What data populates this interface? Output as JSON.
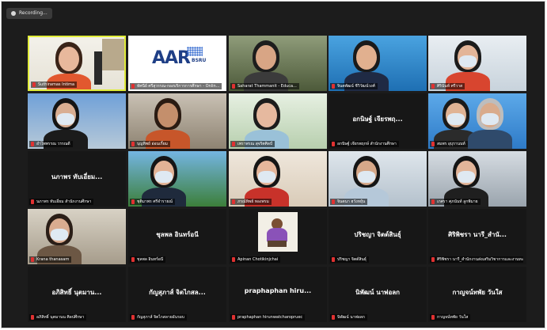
{
  "recording": {
    "label": "Recording..."
  },
  "tiles": [
    {
      "name": "Suthiramas Intima"
    },
    {
      "name": "ทัศนีย์ ศรีสุวรรณ-กองบริการการศึกษา - Onlin..."
    },
    {
      "name": "Saharat Thammanit - Educa..."
    },
    {
      "name": "จินตพัฒน์ ชีวิวัฒน์วงศ์"
    },
    {
      "name": "ศิรินันท์ ศรีวาส"
    },
    {
      "name": "อำไพพรรณ วรรณดี"
    },
    {
      "name": "บุญทิพย์ อ่อนเกิ้ยม"
    },
    {
      "name": "เพราพรณ สุจริตศิลป์"
    },
    {
      "name": "อกนิษฐ์ เจียรพฤ...",
      "sub": "อกนิษฐ์ เจียรพฤกษ์ สำนักงานศึกษา"
    },
    {
      "name": "สมพร อุบุรานนท์"
    },
    {
      "name": "นภาพร ทับเอี่ยม...",
      "sub": "นภาพร ทับเอี่ยม สำนักงานศึกษา"
    },
    {
      "name": "ชุติมาพร ศรีจำรายณ์"
    },
    {
      "name": "ภรณ์ทิพย์ ทองพรม"
    },
    {
      "name": "จินตนา ฮวังหยุ้น"
    },
    {
      "name": "เกศรา ศุภนันท์ ลูกพิมาย"
    },
    {
      "name": "Krana thanasarn"
    },
    {
      "name": "ชุลพล อินทร์อนี",
      "sub": "ชุลพล อินทร์อนี"
    },
    {
      "name": "Apinan Chotikinjchai"
    },
    {
      "name": "ปริชญา จิตต์สินธุ์",
      "sub": "ปริชญา จิตต์สินธุ์"
    },
    {
      "name": "ศิริพิชรา นารี_สำนั...",
      "sub": "ศิริพิชรา นารี_สำนักงานส่งเสริมวิชาการและงานทะเบียน"
    },
    {
      "name": "อภิสิทธิ์ นุตมาน...",
      "sub": "อภิสิทธิ์ นุตมานน ศิลปศึกษา"
    },
    {
      "name": "กัญสุภาส์ จิตไกสล...",
      "sub": "กัญสุภาส์ จิตไกสลายอันรอบ"
    },
    {
      "name": "praphaphan hiru...",
      "sub": "praphaphan hirunwatcharopruec"
    },
    {
      "name": "นิพัฒน์ นาพ่อลก",
      "sub": "นิพัฒน์ นาพ่อลก"
    },
    {
      "name": "กาญจน์ทพัย วันใส",
      "sub": "กาญจน์ทพัย วันใส"
    }
  ],
  "aar_logo": {
    "main": "AAR",
    "sub": "BSRU"
  }
}
